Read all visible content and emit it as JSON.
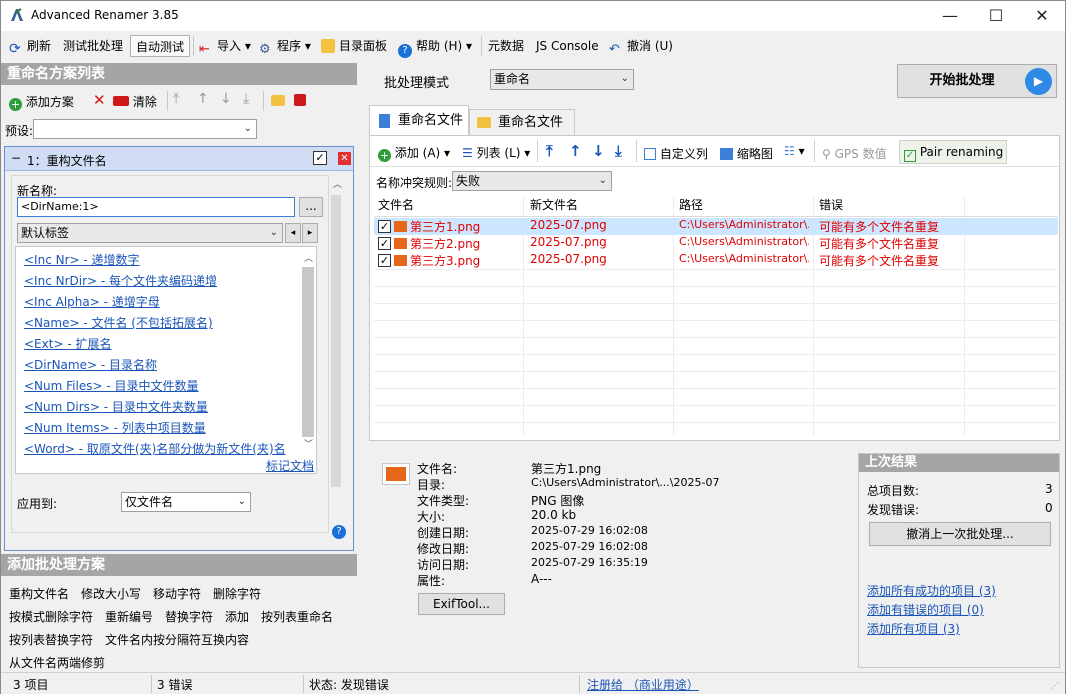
{
  "window": {
    "title": "Advanced Renamer 3.85",
    "minimize": "—",
    "maximize": "☐",
    "close": "✕"
  },
  "toolbar": {
    "refresh": "刷新",
    "test_batch": "测试批处理",
    "auto_test": "自动测试",
    "import": "导入",
    "programs": "程序",
    "dir_panel": "目录面板",
    "help": "帮助 (H)",
    "metadata": "元数据",
    "js_console": "JS Console",
    "undo": "撤消 (U)"
  },
  "left": {
    "methods_title": "重命名方案列表",
    "add_method": "添加方案",
    "clear": "清除",
    "preset_label": "预设:",
    "preset_value": "",
    "method": {
      "header": "1：重构文件名",
      "new_name_label": "新名称:",
      "new_name_value": "<DirName:1>",
      "browse": "...",
      "tag_category": "默认标签",
      "tags": [
        "<Inc Nr> - 递增数字",
        "<Inc NrDir> - 每个文件夹编码递增",
        "<Inc Alpha> - 递增字母",
        "<Name> - 文件名 (不包括拓展名)",
        "<Ext> - 扩展名",
        "<DirName> - 目录名称",
        "<Num Files> - 目录中文件数量",
        "<Num Dirs> - 目录中文件夹数量",
        "<Num Items> - 列表中项目数量",
        "<Word> - 取原文件(夹)名部分做为新文件(夹)名"
      ],
      "tag_doc": "标记文档",
      "apply_label": "应用到:",
      "apply_value": "仅文件名"
    },
    "add_title": "添加批处理方案",
    "add_methods": [
      "重构文件名",
      "修改大小写",
      "移动字符",
      "删除字符",
      "按模式删除字符",
      "重新编号",
      "替换字符",
      "添加",
      "按列表重命名",
      "按列表替换字符",
      "文件名内按分隔符互换内容",
      "从文件名两端修剪"
    ]
  },
  "right": {
    "batch_mode_label": "批处理模式",
    "batch_mode_value": "重命名",
    "start_button": "开始批处理",
    "tabs": [
      "重命名文件",
      "重命名文件夹"
    ],
    "file_toolbar": {
      "add": "添加 (A)",
      "list": "列表 (L)",
      "custom_columns": "自定义列",
      "thumbnails": "缩略图",
      "gps": "GPS 数值",
      "pair": "Pair renaming"
    },
    "conflict_label": "名称冲突规则:",
    "conflict_value": "失败",
    "columns": [
      "文件名",
      "新文件名",
      "路径",
      "错误"
    ],
    "files": [
      {
        "name": "第三方1.png",
        "new_name": "2025-07.png",
        "path": "C:\\Users\\Administrator\\...",
        "error": "可能有多个文件名重复"
      },
      {
        "name": "第三方2.png",
        "new_name": "2025-07.png",
        "path": "C:\\Users\\Administrator\\...",
        "error": "可能有多个文件名重复"
      },
      {
        "name": "第三方3.png",
        "new_name": "2025-07.png",
        "path": "C:\\Users\\Administrator\\...",
        "error": "可能有多个文件名重复"
      }
    ],
    "details": [
      {
        "label": "文件名:",
        "value": "第三方1.png"
      },
      {
        "label": "目录:",
        "value": "C:\\Users\\Administrator\\...\\2025-07"
      },
      {
        "label": "文件类型:",
        "value": "PNG 图像"
      },
      {
        "label": "大小:",
        "value": "20.0 kb"
      },
      {
        "label": "创建日期:",
        "value": "2025-07-29 16:02:08"
      },
      {
        "label": "修改日期:",
        "value": "2025-07-29 16:02:08"
      },
      {
        "label": "访问日期:",
        "value": "2025-07-29 16:35:19"
      },
      {
        "label": "属性:",
        "value": "A---"
      }
    ],
    "exiftool": "ExifTool...",
    "last_result": {
      "title": "上次结果",
      "total_label": "总项目数:",
      "total_value": "3",
      "errors_label": "发现错误:",
      "errors_value": "0",
      "undo_button": "撤消上一次批处理...",
      "links": [
        "添加所有成功的项目 (3)",
        "添加有错误的项目 (0)",
        "添加所有项目 (3)"
      ]
    }
  },
  "status": {
    "items": "3 项目",
    "errors": "3 错误",
    "state": "状态: 发现错误",
    "register": "注册给 （商业用途）"
  }
}
